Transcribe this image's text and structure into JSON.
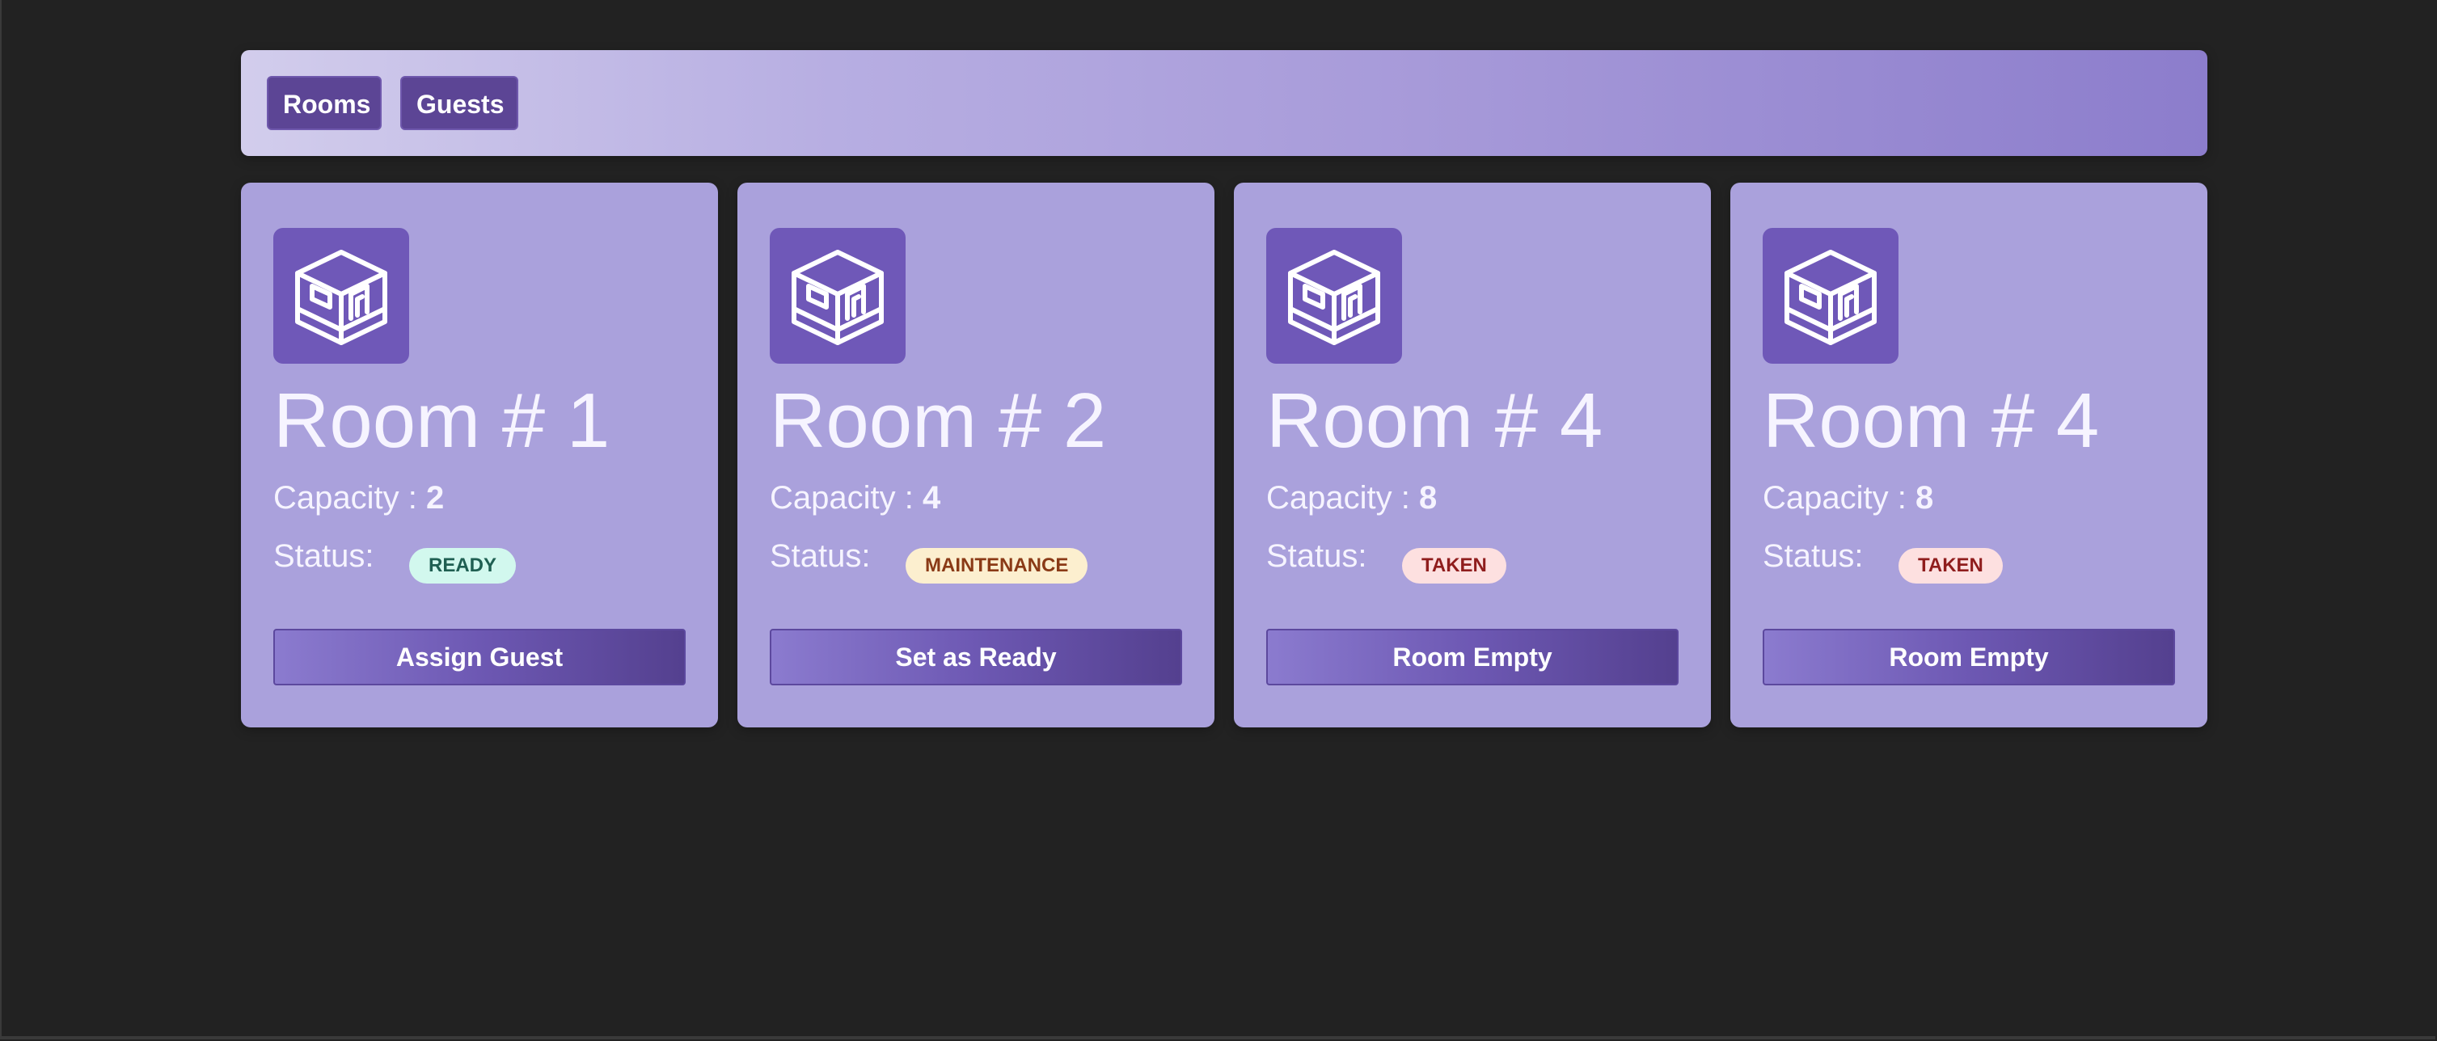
{
  "nav": {
    "rooms_label": "Rooms",
    "guests_label": "Guests"
  },
  "rooms": [
    {
      "title": "Room # 1",
      "capacity_label": "Capacity : ",
      "capacity_value": "2",
      "status_label": "Status:",
      "status": "READY",
      "action_label": "Assign Guest",
      "icon": "room-cube-icon"
    },
    {
      "title": "Room # 2",
      "capacity_label": "Capacity : ",
      "capacity_value": "4",
      "status_label": "Status:",
      "status": "MAINTENANCE",
      "action_label": "Set as Ready",
      "icon": "room-cube-icon"
    },
    {
      "title": "Room # 4",
      "capacity_label": "Capacity : ",
      "capacity_value": "8",
      "status_label": "Status:",
      "status": "TAKEN",
      "action_label": "Room Empty",
      "icon": "room-cube-icon"
    },
    {
      "title": "Room # 4",
      "capacity_label": "Capacity : ",
      "capacity_value": "8",
      "status_label": "Status:",
      "status": "TAKEN",
      "action_label": "Room Empty",
      "icon": "room-cube-icon"
    }
  ],
  "colors": {
    "background": "#222222",
    "card": "#aaa1dc",
    "accent": "#6f58b8",
    "nav_button": "#5c4595",
    "status_ready_bg": "#d2f8ee",
    "status_maintenance_bg": "#fcefcf",
    "status_taken_bg": "#fde0e0"
  }
}
